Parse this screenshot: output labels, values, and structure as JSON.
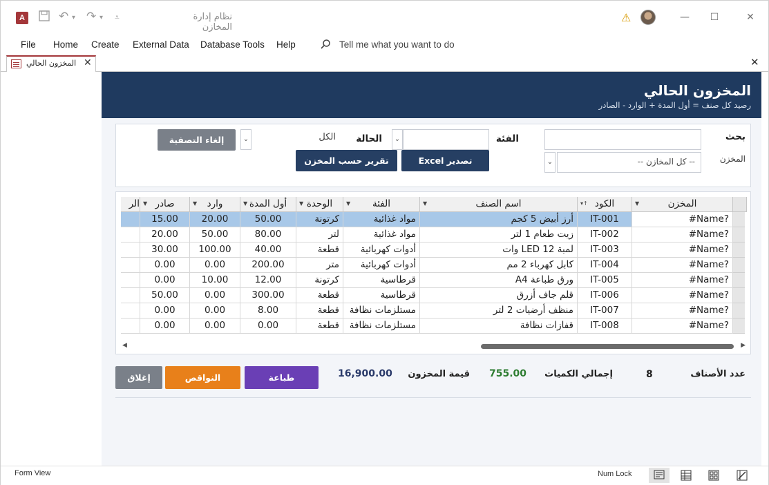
{
  "titlebar": {
    "title": "نظام إدارة المخازن",
    "min_glyph": "—",
    "max_glyph": "☐",
    "close_glyph": "✕"
  },
  "menu": {
    "items": [
      "File",
      "Home",
      "Create",
      "External Data",
      "Database Tools",
      "Help"
    ],
    "tell_me": "Tell me what you want to do"
  },
  "doc_tab": {
    "label": "المخزون الحالي"
  },
  "form": {
    "title": "المخزون الحالي",
    "subtitle": "رصيد كل صنف = أول المدة + الوارد - الصادر",
    "search_label": "بحث",
    "store_label": "المخزن",
    "store_value": "-- كل المخازن --",
    "category_label": "الفئة",
    "status_label": "الحالة",
    "status_value": "الكل",
    "clear_filter": "إلغاء التصفية",
    "export_excel": "تصدير Excel",
    "report_by_store": "تقرير حسب المخزن"
  },
  "grid": {
    "columns": [
      "المخزن",
      "الكود",
      "اسم الصنف",
      "الفئة",
      "الوحدة",
      "أول المدة",
      "وارد",
      "صادر",
      "الر"
    ],
    "rows": [
      {
        "store": "#Name?",
        "code": "IT-001",
        "name": "أرز أبيض 5 كجم",
        "category": "مواد غذائية",
        "unit": "كرتونة",
        "opening": "50.00",
        "in": "20.00",
        "out": "15.00"
      },
      {
        "store": "#Name?",
        "code": "IT-002",
        "name": "زيت طعام 1 لتر",
        "category": "مواد غذائية",
        "unit": "لتر",
        "opening": "80.00",
        "in": "50.00",
        "out": "20.00"
      },
      {
        "store": "#Name?",
        "code": "IT-003",
        "name": "لمبة LED 12 وات",
        "category": "أدوات كهربائية",
        "unit": "قطعة",
        "opening": "40.00",
        "in": "100.00",
        "out": "30.00"
      },
      {
        "store": "#Name?",
        "code": "IT-004",
        "name": "كابل كهرباء 2 مم",
        "category": "أدوات كهربائية",
        "unit": "متر",
        "opening": "200.00",
        "in": "0.00",
        "out": "0.00"
      },
      {
        "store": "#Name?",
        "code": "IT-005",
        "name": "ورق طباعة A4",
        "category": "قرطاسية",
        "unit": "كرتونة",
        "opening": "12.00",
        "in": "10.00",
        "out": "0.00"
      },
      {
        "store": "#Name?",
        "code": "IT-006",
        "name": "قلم جاف أزرق",
        "category": "قرطاسية",
        "unit": "قطعة",
        "opening": "300.00",
        "in": "0.00",
        "out": "50.00"
      },
      {
        "store": "#Name?",
        "code": "IT-007",
        "name": "منظف أرضيات 2 لتر",
        "category": "مستلزمات نظافة",
        "unit": "قطعة",
        "opening": "8.00",
        "in": "0.00",
        "out": "0.00"
      },
      {
        "store": "#Name?",
        "code": "IT-008",
        "name": "قفازات نظافة",
        "category": "مستلزمات نظافة",
        "unit": "قطعة",
        "opening": "0.00",
        "in": "0.00",
        "out": "0.00"
      }
    ]
  },
  "footer": {
    "items_count_label": "عدد الأصناف",
    "items_count": "8",
    "total_qty_label": "إجمالي الكميات",
    "total_qty": "755.00",
    "stock_value_label": "قيمة المخزون",
    "stock_value": "16,900.00",
    "print": "طباعة",
    "shortages": "النواقص",
    "close": "إغلاق"
  },
  "status": {
    "left": "Form View",
    "num_lock": "Num Lock"
  },
  "colors": {
    "header": "#1f3a5f",
    "selected_row": "#a8c8e8",
    "total_qty": "#2e7d32",
    "stock_value": "#2a3a6a"
  }
}
